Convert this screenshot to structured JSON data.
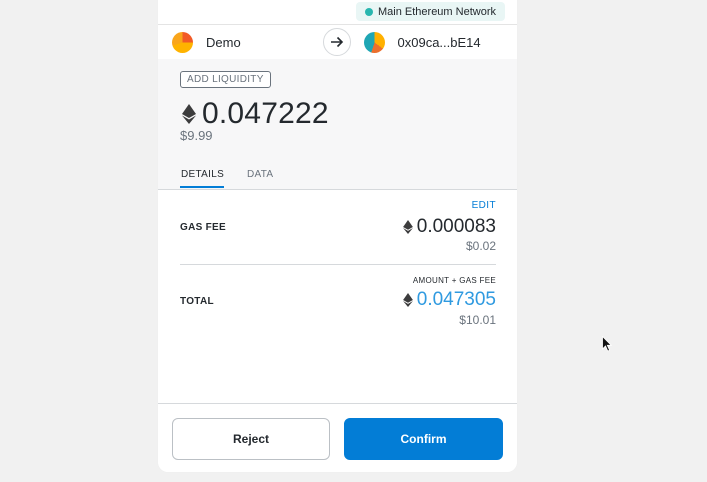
{
  "network": {
    "name": "Main Ethereum Network",
    "dot_color": "#29b6af"
  },
  "accounts": {
    "from": {
      "name": "Demo",
      "identicon": "identicon-orange"
    },
    "arrow_icon": "arrow-right-icon",
    "to": {
      "name": "0x09ca...bE14",
      "identicon": "identicon-multicolor"
    }
  },
  "summary": {
    "method": "ADD LIQUIDITY",
    "amount": "0.047222",
    "fiat": "$9.99",
    "currency_icon": "eth-icon"
  },
  "tabs": [
    {
      "label": "DETAILS",
      "active": true
    },
    {
      "label": "DATA",
      "active": false
    }
  ],
  "details": {
    "edit_label": "EDIT",
    "gas_fee": {
      "label": "GAS FEE",
      "amount": "0.000083",
      "fiat": "$0.02"
    },
    "total": {
      "sublabel": "AMOUNT + GAS FEE",
      "label": "TOTAL",
      "amount": "0.047305",
      "fiat": "$10.01"
    }
  },
  "footer": {
    "reject_label": "Reject",
    "confirm_label": "Confirm"
  },
  "colors": {
    "accent": "#037dd6",
    "total_value": "#2f9ae0"
  }
}
